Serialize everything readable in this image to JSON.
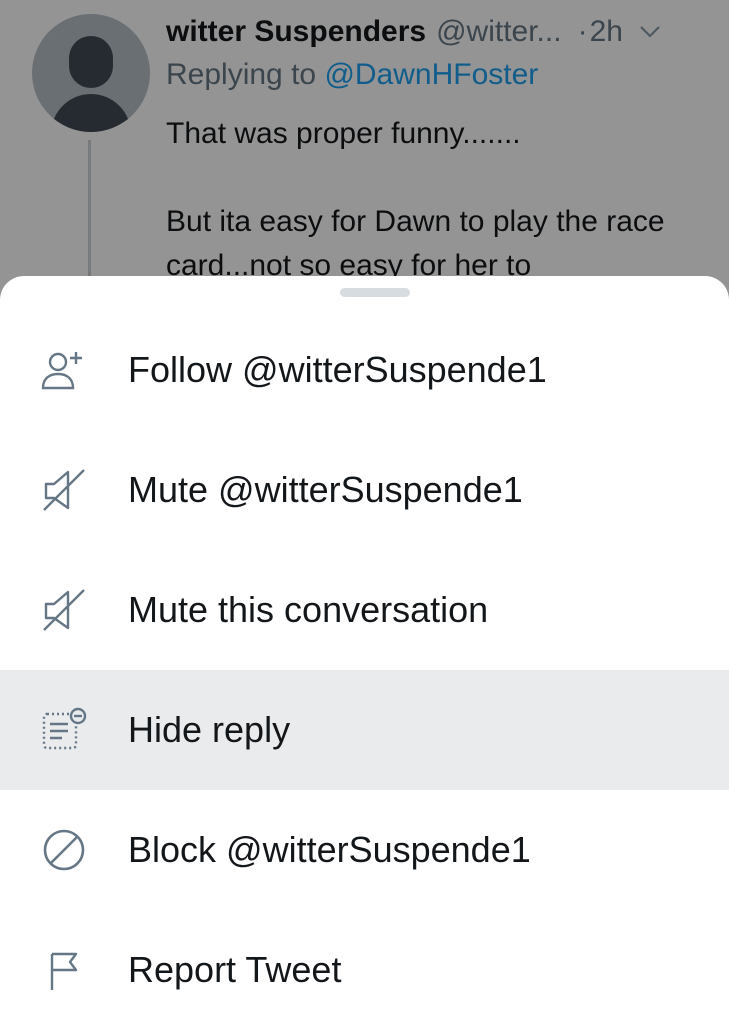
{
  "tweet": {
    "display_name": "witter Suspenders",
    "handle": "@witter...",
    "separator": "·",
    "time": "2h",
    "replying_prefix": "Replying to",
    "replying_handle": "@DawnHFoster",
    "text_line1": "That was proper funny.......",
    "text_line2": "But ita easy for Dawn to play the race card...not so easy for her to"
  },
  "menu": {
    "items": [
      {
        "label": "Follow @witterSuspende1",
        "icon": "follow-user-icon"
      },
      {
        "label": "Mute @witterSuspende1",
        "icon": "mute-icon"
      },
      {
        "label": "Mute this conversation",
        "icon": "mute-conversation-icon"
      },
      {
        "label": "Hide reply",
        "icon": "hide-reply-icon"
      },
      {
        "label": "Block @witterSuspende1",
        "icon": "block-icon"
      },
      {
        "label": "Report Tweet",
        "icon": "flag-icon"
      }
    ]
  },
  "colors": {
    "text": "#14171a",
    "secondary": "#657786",
    "link": "#1da1f2",
    "highlight": "#e9ebed",
    "icon": "#657786"
  }
}
